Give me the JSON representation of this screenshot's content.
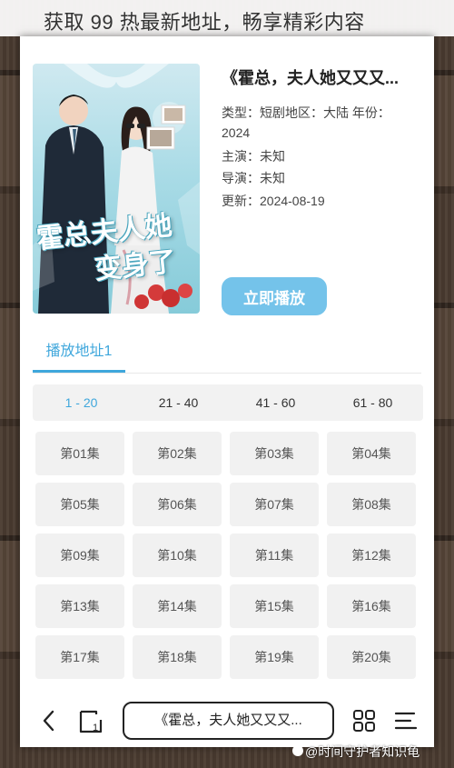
{
  "banner": {
    "text": "获取 99 热最新地址，畅享精彩内容"
  },
  "poster": {
    "title_line1": "霍总夫人她",
    "title_line2": "变身了"
  },
  "show": {
    "title": "《霍总，夫人她又又又...",
    "type_line": "类型：短剧地区：大陆 年份：",
    "year_value": "2024",
    "cast_line": "主演：未知",
    "director_line": "导演：未知",
    "updated_line": "更新：2024-08-19"
  },
  "play_button": {
    "label": "立即播放"
  },
  "source_tab": {
    "label": "播放地址1"
  },
  "ranges": [
    "1 - 20",
    "21 - 40",
    "41 - 60",
    "61 - 80"
  ],
  "episodes": [
    "第01集",
    "第02集",
    "第03集",
    "第04集",
    "第05集",
    "第06集",
    "第07集",
    "第08集",
    "第09集",
    "第10集",
    "第11集",
    "第12集",
    "第13集",
    "第14集",
    "第15集",
    "第16集",
    "第17集",
    "第18集",
    "第19集",
    "第20集"
  ],
  "bottom_bar": {
    "url_text": "《霍总，夫人她又又又..."
  },
  "watermark": {
    "text": "@时间守护者知识龟"
  },
  "colors": {
    "accent": "#3fa7dc",
    "play_button": "#74c3ea"
  }
}
